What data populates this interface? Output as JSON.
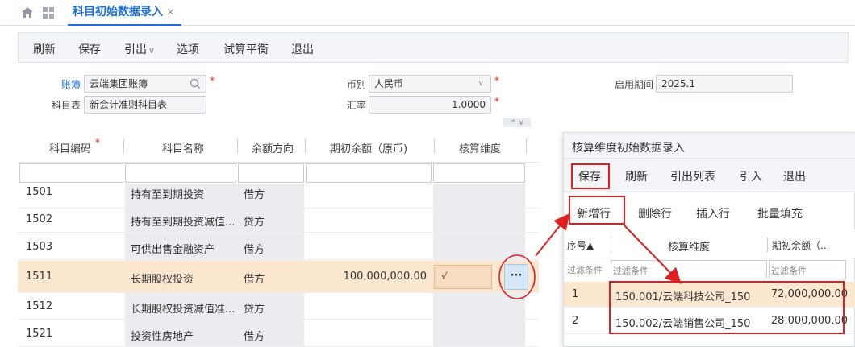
{
  "tabs": {
    "active_label": "科目初始数据录入",
    "close_glyph": "×"
  },
  "toolbar": {
    "refresh": "刷新",
    "save": "保存",
    "export": "引出",
    "export_caret": "∨",
    "options": "选项",
    "trial_balance": "试算平衡",
    "exit": "退出"
  },
  "form": {
    "ledger_label": "账簿",
    "ledger_value": "云端集团账簿",
    "currency_label": "币别",
    "currency_value": "人民币",
    "start_period_label": "启用期间",
    "start_period_value": "2025.1",
    "chart_label": "科目表",
    "chart_value": "新会计准则科目表",
    "rate_label": "汇率",
    "rate_value": "1.0000"
  },
  "grid": {
    "headers": [
      "科目编码",
      "科目名称",
      "余额方向",
      "期初余额（原币)",
      "核算维度"
    ],
    "rows": [
      {
        "code": "1501",
        "name": "持有至到期投资",
        "direction": "借方",
        "amount": "",
        "dim": ""
      },
      {
        "code": "1502",
        "name": "持有至到期投资减值...",
        "direction": "贷方",
        "amount": "",
        "dim": ""
      },
      {
        "code": "1503",
        "name": "可供出售金融资产",
        "direction": "借方",
        "amount": "",
        "dim": ""
      },
      {
        "code": "1511",
        "name": "长期股权投资",
        "direction": "借方",
        "amount": "100,000,000.00",
        "dim": "√"
      },
      {
        "code": "1512",
        "name": "长期股权投资减值准...",
        "direction": "贷方",
        "amount": "",
        "dim": ""
      },
      {
        "code": "1521",
        "name": "投资性房地产",
        "direction": "借方",
        "amount": "",
        "dim": ""
      }
    ],
    "ellipsis": "···"
  },
  "panel": {
    "title": "核算维度初始数据录入",
    "toolbar": {
      "save": "保存",
      "refresh": "刷新",
      "export_list": "引出列表",
      "import": "引入",
      "exit": "退出"
    },
    "row_actions": {
      "add_row": "新增行",
      "delete_row": "删除行",
      "insert_row": "插入行",
      "batch_fill": "批量填充"
    },
    "headers": {
      "seq": "序号▲",
      "dimension": "核算维度",
      "amount": "期初余额（..."
    },
    "filter_placeholder": "过滤条件",
    "rows": [
      {
        "seq": "1",
        "dimension": "150.001/云端科技公司_150",
        "amount": "72,000,000.00"
      },
      {
        "seq": "2",
        "dimension": "150.002/云端销售公司_150",
        "amount": "28,000,000.00"
      }
    ]
  },
  "colors": {
    "accent": "#1e6fd9",
    "highlight_row": "#fbe7cf",
    "annotation_red": "#e02020"
  }
}
